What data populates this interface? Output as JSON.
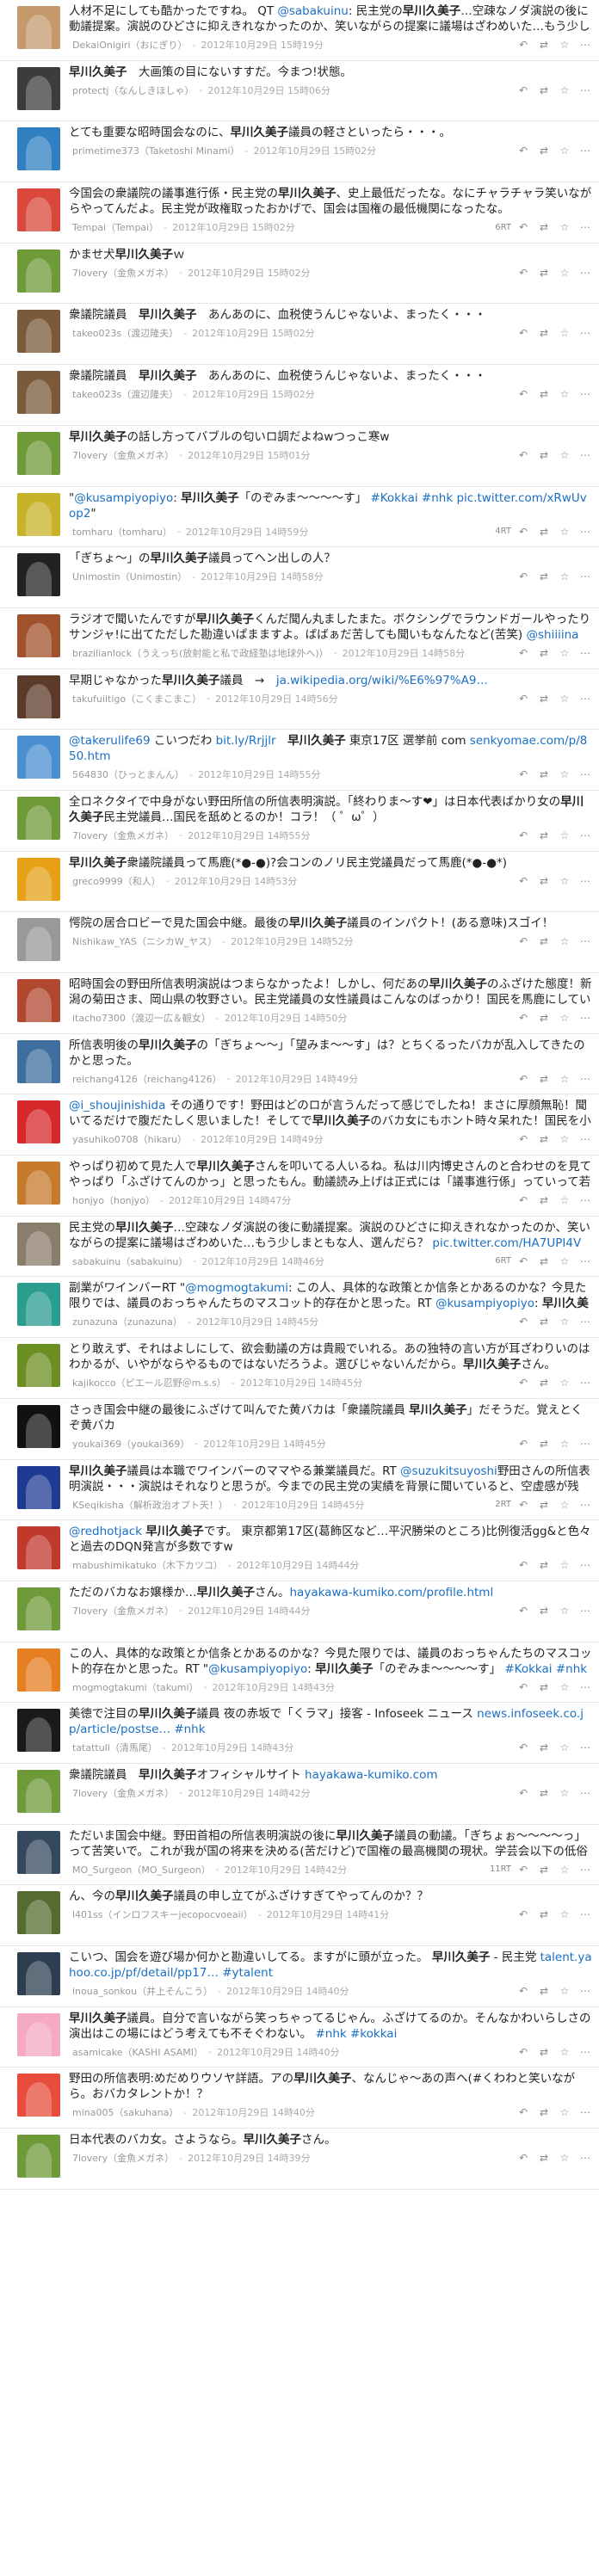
{
  "tweets": [
    {
      "text": "人材不足にしても酷かったですね。 QT @sabakuinu: 民主党の早川久美子…空疎なノダ演説の後に動議提案。演説のひどさに抑えきれなかったのか、笑いながらの提案に議場はざわめいた…もう少しまともな人、選んだら？ pic.twitter.com/mrs2rf6S",
      "display_name": "DekaiOnigiri（おにぎり）",
      "date": "2012年10月29日 15時19分",
      "rt_count": "",
      "avatar_color": "#c49a6c"
    },
    {
      "text": "早川久美子　大画策の目にないすすだ。今まつ!状態。",
      "display_name": "protectj（なんしきほしゃ）",
      "date": "2012年10月29日 15時06分",
      "rt_count": "",
      "avatar_color": "#3c3c3c"
    },
    {
      "text": "とても重要な昭時国会なのに、早川久美子議員の軽さといったら・・・。",
      "display_name": "primetime373（Taketoshi Minami）",
      "date": "2012年10月29日 15時02分",
      "rt_count": "",
      "avatar_color": "#2f7fc1"
    },
    {
      "text": "今国会の衆議院の議事進行係・民主党の早川久美子、史上最低だったな。なにチャラチャラ笑いながらやってんだよ。民主党が政権取ったおかげで、国会は国権の最低機関になったな。",
      "display_name": "Tempai（Tempai）",
      "date": "2012年10月29日 15時02分",
      "rt_count": "6RT",
      "avatar_color": "#d9483b"
    },
    {
      "text": "かませ犬早川久美子ｗ",
      "display_name": "7lovery（金魚メガネ）",
      "date": "2012年10月29日 15時02分",
      "rt_count": "",
      "avatar_color": "#6f9a3a"
    },
    {
      "text": "衆議院議員　早川久美子　あんあのに、血税使うんじゃないよ、まったく・・・",
      "display_name": "takeo023s（渡辺隆夫）",
      "date": "2012年10月29日 15時02分",
      "rt_count": "",
      "avatar_color": "#7a5a3a"
    },
    {
      "text": "衆議院議員　早川久美子　あんあのに、血税使うんじゃないよ、まったく・・・",
      "display_name": "takeo023s（渡辺隆夫）",
      "date": "2012年10月29日 15時02分",
      "rt_count": "",
      "avatar_color": "#7a5a3a"
    },
    {
      "text": "早川久美子の話し方ってバブルの匂いロ調だよねwつっこ寒w",
      "display_name": "7lovery（金魚メガネ）",
      "date": "2012年10月29日 15時01分",
      "rt_count": "",
      "avatar_color": "#6f9a3a"
    },
    {
      "text": "\"@kusampiyopiyo: 早川久美子「のぞみま〜〜〜〜す」 #Kokkai #nhk pic.twitter.com/xRwUvop2\"",
      "display_name": "tomharu（tomharu）",
      "date": "2012年10月29日 14時59分",
      "rt_count": "4RT",
      "avatar_color": "#c8b227"
    },
    {
      "text": "「ぎちょ〜」の早川久美子議員ってヘン出しの人？",
      "display_name": "Unimostin（Unimostin）",
      "date": "2012年10月29日 14時58分",
      "rt_count": "",
      "avatar_color": "#222222"
    },
    {
      "text": "ラジオで聞いたんですが早川久美子くんだ聞ん丸ましたまた。ボクシングでラウンドガールやったりサンジャ!に出てただした勘違いぱまますよ。ばばぁだ苦しても聞いもなんたなど(苦笑) @shiiiina あのバカ女は誰でしょう？どこの議員ですか？",
      "display_name": "brazilianlock（うえっち(放射能と私で政経塾は地球外へ)）",
      "date": "2012年10月29日 14時58分",
      "rt_count": "",
      "avatar_color": "#a0522d"
    },
    {
      "text": "早期じゃなかった早川久美子議員　→　ja.wikipedia.org/wiki/%E6%97%A9…",
      "display_name": "takufuiitigo（こくまこまこ）",
      "date": "2012年10月29日 14時56分",
      "rt_count": "",
      "avatar_color": "#5b3a29"
    },
    {
      "text": "@takerulife69 こいつだわ bit.ly/Rrjjlr　早川久美子 東京17区 選挙前 com senkyomae.com/p/850.htm",
      "display_name": "564830（ひっとまんん）",
      "date": "2012年10月29日 14時55分",
      "rt_count": "",
      "avatar_color": "#4a8fd0"
    },
    {
      "text": "全ロネクタイで中身がない野田所信の所信表明演説。「終わりま〜す❤」は日本代表ばかり女の早川久美子民主党議員…国民を舐めとるのか！コラ！（ ゜ω゜）",
      "display_name": "7lovery（金魚メガネ）",
      "date": "2012年10月29日 14時55分",
      "rt_count": "",
      "avatar_color": "#6f9a3a"
    },
    {
      "text": "早川久美子衆議院議員って馬鹿(*●-●)?会コンのノリ民主党議員だって馬鹿(*●-●*)",
      "display_name": "greco9999（和人）",
      "date": "2012年10月29日 14時53分",
      "rt_count": "",
      "avatar_color": "#e6a117"
    },
    {
      "text": "愕院の居合ロビーで見た国会中継。最後の早川久美子議員のインパクト！(ある意味)スゴイ！",
      "display_name": "Nishikaw_YAS（ニシカW_ヤス）",
      "date": "2012年10月29日 14時52分",
      "rt_count": "",
      "avatar_color": "#999999"
    },
    {
      "text": "昭時国会の野田所信表明演説はつまらなかったよ！しかし、何だあの早川久美子のふざけた態度！新潟の菊田さま、岡山県の牧野さい。民主党議員の女性議員はこんなのばっかり！国民を馬鹿にしているの一言に尽きる (\"`Д´\")",
      "display_name": "itacho7300（渡辺一広＆観女）",
      "date": "2012年10月29日 14時50分",
      "rt_count": "",
      "avatar_color": "#b2472f"
    },
    {
      "text": "所信表明後の早川久美子の「ぎちょ〜〜」「望みま〜〜す」は？とちくるったバカが乱入してきたのかと思った。",
      "display_name": "reichang4126（reichang4126）",
      "date": "2012年10月29日 14時49分",
      "rt_count": "",
      "avatar_color": "#3e6f9e"
    },
    {
      "text": "@i_shoujinishida その通りです！野田はどのロが言うんだって感じでしたね！まさに厚顔無恥！聞いてるだけで腹だたしく思いました！そしてで早川久美子のバカ女にもホント時々呆れた！国民を小馬鹿にしているにもほどがあります。どうかあの場で民主党を徹底的に追い込んで下さい！",
      "display_name": "yasuhiko0708（hikaru）",
      "date": "2012年10月29日 14時49分",
      "rt_count": "",
      "avatar_color": "#d62828"
    },
    {
      "text": "やっぱり初めて見た人で早川久美子さんを叩いてる人いるね。私は川内博史さんのと合わせのを見てやっぱり「ふざけてんのかっ」と思ったもん。動議読み上げは正式には「議事進行係」っていって若手政治家の登竜門なのだとか。不思議でしょうがない。ja.wikipedia.org/wiki/%E8%AD%B0…",
      "display_name": "honjyo（honjyo）",
      "date": "2012年10月29日 14時47分",
      "rt_count": "",
      "avatar_color": "#c67a2c"
    },
    {
      "text": "民主党の早川久美子…空疎なノダ演説の後に動議提案。演説のひどさに抑えきれなかったのか、笑いながらの提案に議場はざわめいた…もう少しまともな人、選んだら？ pic.twitter.com/HA7UPI4V",
      "display_name": "sabakuinu（sabakuinu）",
      "date": "2012年10月29日 14時46分",
      "rt_count": "6RT",
      "avatar_color": "#8b7d6b"
    },
    {
      "text": "副業がワインバーRT \"@mogmogtakumi: この人、具体的な政策とか信条とかあるのかな？今見た限りでは、議員のおっちゃんたちのマスコット的存在かと思った。RT @kusampiyopiyo: 早川久美子「のぞみま〜〜〜〜す」 #Kokkai #nhk pic.twitter.com/7yCYFUq5\"",
      "display_name": "zunazuna（zunazuna）",
      "date": "2012年10月29日 14時45分",
      "rt_count": "",
      "avatar_color": "#2a9d8f"
    },
    {
      "text": "とり敢えず、それはよしにして、欲会動議の方は貴殿でいれる。あの独特の言い方が耳ざわりいのはわかるが、いやがならやるものではないだろうよ。選びじゃないんだから。早川久美子さん。",
      "display_name": "kajikocco（ピエール忍野＠m.s.s）",
      "date": "2012年10月29日 14時45分",
      "rt_count": "",
      "avatar_color": "#6b8e23"
    },
    {
      "text": "さっき国会中継の最後にふざけて叫んでた黄バカは「衆議院議員 早川久美子」だそうだ。覚えとくぞ黄バカ",
      "display_name": "youkai369（youkai369）",
      "date": "2012年10月29日 14時45分",
      "rt_count": "",
      "avatar_color": "#111111"
    },
    {
      "text": "早川久美子議員は本職でワインバーのママやる兼業議員だ。RT @suzukitsuyoshi野田さんの所信表明演説・・・演説はそれなりと思うが。今までの民主党の実績を背景に聞いていると、空虚感が残る。ところで、何時ものことは言う「議長〜〜〜〜」と早川議員な人物が",
      "display_name": "KSeqikisha（解析政治オプト天！）",
      "date": "2012年10月29日 14時45分",
      "rt_count": "2RT",
      "avatar_color": "#1f3a93"
    },
    {
      "text": "@redhotjack 早川久美子です。 東京都第17区(葛飾区など…平沢勝栄のところ)比例復活gg&と色々と過去のDQN発言が多数ですw",
      "display_name": "mabushimikatuko（木下カツコ）",
      "date": "2012年10月29日 14時44分",
      "rt_count": "",
      "avatar_color": "#c0392b"
    },
    {
      "text": "ただのバカなお嬢様か…早川久美子さん。hayakawa-kumiko.com/profile.html",
      "display_name": "7lovery（金魚メガネ）",
      "date": "2012年10月29日 14時44分",
      "rt_count": "",
      "avatar_color": "#6f9a3a"
    },
    {
      "text": "この人、具体的な政策とか信条とかあるのかな？今見た限りでは、議員のおっちゃんたちのマスコット的存在かと思った。RT \"@kusampiyopiyo: 早川久美子「のぞみま〜〜〜〜す」 #Kokkai #nhk pic.twitter.com/lzb5ZV5Q\"",
      "display_name": "mogmogtakumi（takumi）",
      "date": "2012年10月29日 14時43分",
      "rt_count": "",
      "avatar_color": "#e67e22"
    },
    {
      "text": "美徳で注目の早川久美子議員 夜の赤坂で「くラマ」接客 - Infoseek ニュース news.infoseek.co.jp/article/postse… #nhk",
      "display_name": "tatattull（清馬尾）",
      "date": "2012年10月29日 14時43分",
      "rt_count": "",
      "avatar_color": "#1a1a1a"
    },
    {
      "text": "衆議院議員　早川久美子オフィシャルサイト hayakawa-kumiko.com",
      "display_name": "7lovery（金魚メガネ）",
      "date": "2012年10月29日 14時42分",
      "rt_count": "",
      "avatar_color": "#6f9a3a"
    },
    {
      "text": "ただいま国会中継。野田首相の所信表明演説の後に早川久美子議員の動議。「ぎちょぉ〜〜〜〜っ」って苦笑いで。これが我が国の将来を決める(苦だけど)で国権の最高機関の現状。学芸会以下の低俗さ。見ていて私がとても耳ざわりい気持ちになりました。",
      "display_name": "MO_Surgeon（MO_Surgeon）",
      "date": "2012年10月29日 14時42分",
      "rt_count": "11RT",
      "avatar_color": "#34495e"
    },
    {
      "text": "ん、今の早川久美子議員の申し立てがふざけすぎてやってんのか？？",
      "display_name": "l401ss（インロフスキーjecopocvoeaii）",
      "date": "2012年10月29日 14時41分",
      "rt_count": "",
      "avatar_color": "#556b2f"
    },
    {
      "text": "こいつ、国会を遊び場か何かと勘違いしてる。ますがに頭が立った。 早川久美子 - 民主党 talent.yahoo.co.jp/pf/detail/pp17… #ytalent",
      "display_name": "inoua_sonkou（井上そんこう）",
      "date": "2012年10月29日 14時40分",
      "rt_count": "",
      "avatar_color": "#2c3e50"
    },
    {
      "text": "早川久美子議員。自分で言いながら笑っちゃってるじゃん。ふざけてるのか。そんなかわいらしさの演出はこの場にはどう考えても不そぐわない。 #nhk #kokkai",
      "display_name": "asamicake（KASHI ASAMI）",
      "date": "2012年10月29日 14時40分",
      "rt_count": "",
      "avatar_color": "#f5a9c4"
    },
    {
      "text": "野田の所信表明:めだめりウソヤ詳語。アの早川久美子、なんじゃ〜あの声ヘ(#くわわと笑いながら。おバカタレントか！？",
      "display_name": "mina005（sakuhana）",
      "date": "2012年10月29日 14時40分",
      "rt_count": "",
      "avatar_color": "#e74c3c"
    },
    {
      "text": "日本代表のバカ女。さようなら。早川久美子さん。",
      "display_name": "7lovery（金魚メガネ）",
      "date": "2012年10月29日 14時39分",
      "rt_count": "",
      "avatar_color": "#6f9a3a"
    }
  ],
  "actions": {
    "reply_icon": "reply-icon",
    "retweet_icon": "retweet-icon",
    "favorite_icon": "favorite-icon",
    "more_icon": "more-icon"
  },
  "colors": {
    "link": "#1a6fc4",
    "meta": "#999999",
    "divider": "#e5e5e5"
  }
}
